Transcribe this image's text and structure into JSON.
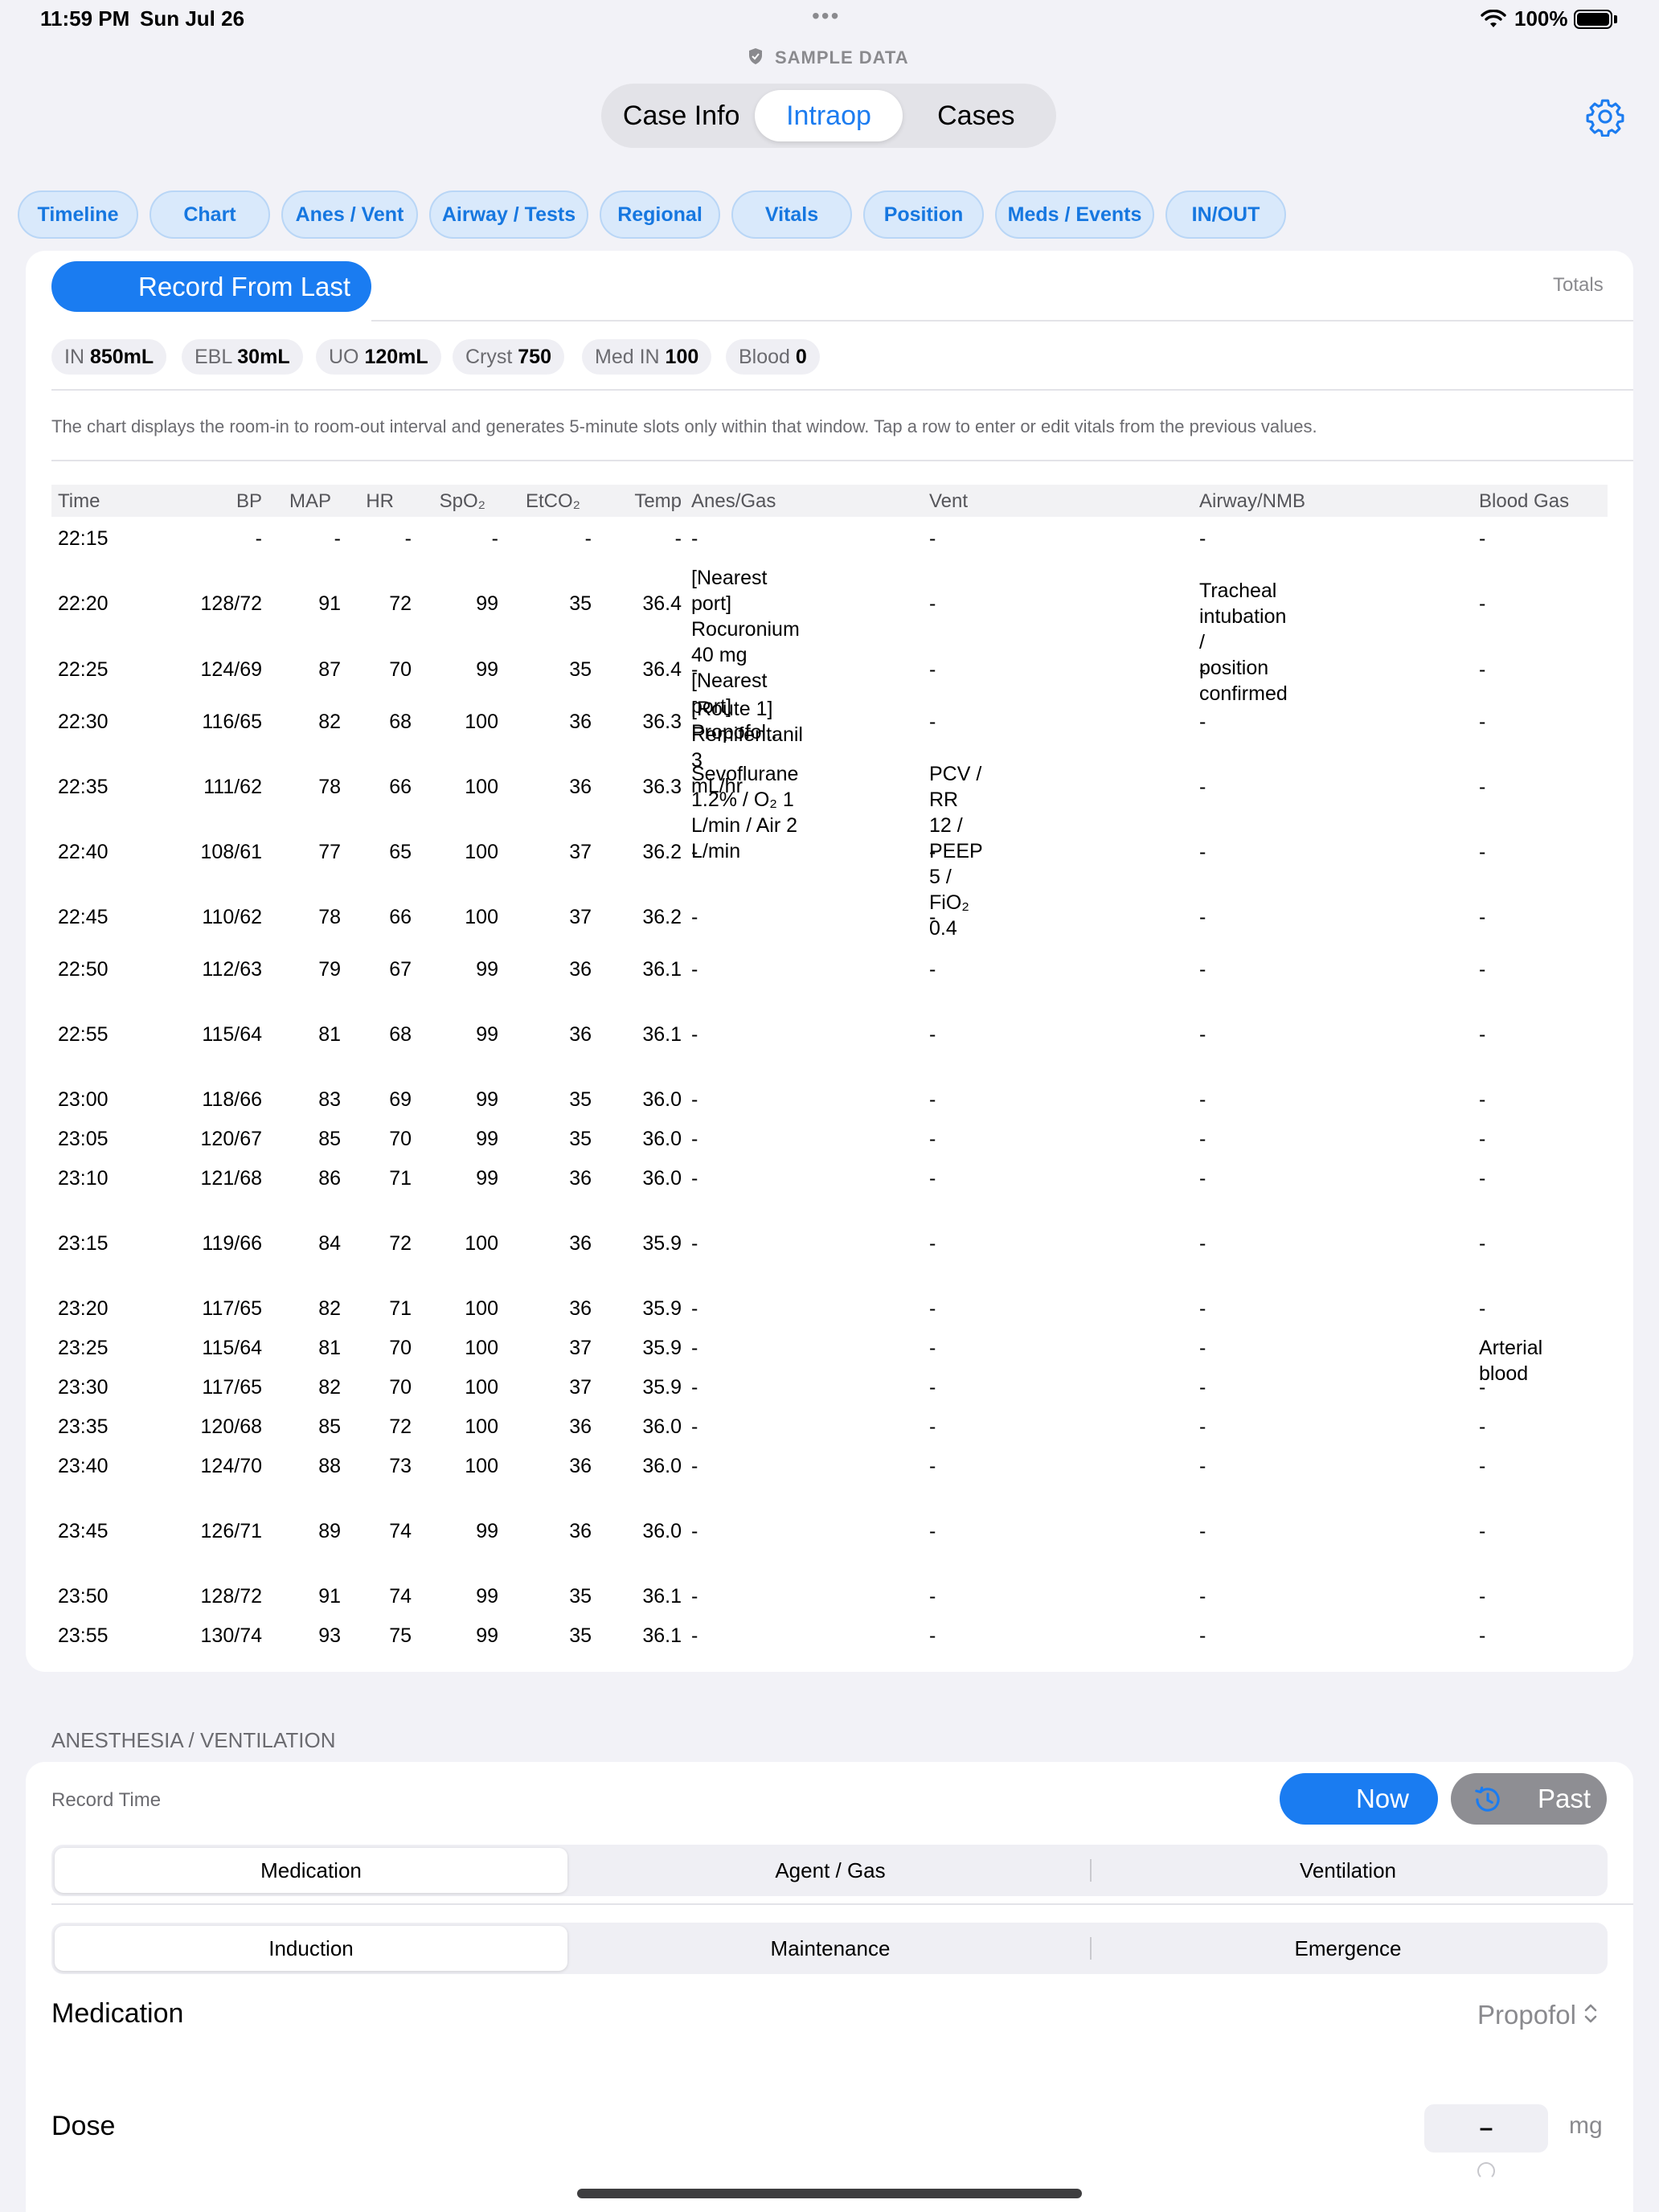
{
  "status_bar": {
    "time": "11:59 PM",
    "date": "Sun Jul 26",
    "dots": "•••",
    "battery": "100%"
  },
  "sample_data_label": "SAMPLE DATA",
  "main_tabs": [
    "Case Info",
    "Intraop",
    "Cases"
  ],
  "section_tabs": [
    "Timeline",
    "Chart",
    "Anes / Vent",
    "Airway / Tests",
    "Regional",
    "Vitals",
    "Position",
    "Meds / Events",
    "IN/OUT"
  ],
  "chart_card": {
    "record_from_last": "Record From Last",
    "totals_label": "Totals",
    "totals": [
      {
        "label": "IN",
        "value": "850mL"
      },
      {
        "label": "EBL",
        "value": "30mL"
      },
      {
        "label": "UO",
        "value": "120mL"
      },
      {
        "label": "Cryst",
        "value": "750"
      },
      {
        "label": "Med IN",
        "value": "100"
      },
      {
        "label": "Blood",
        "value": "0"
      }
    ],
    "description": "The chart displays the room-in to room-out interval and generates 5-minute slots only within that window. Tap a row to enter or edit vitals from the previous values."
  },
  "table": {
    "headers": [
      "Time",
      "BP",
      "MAP",
      "HR",
      "SpO₂",
      "EtCO₂",
      "Temp",
      "Anes/Gas",
      "Vent",
      "Airway/NMB",
      "Blood Gas"
    ],
    "rows": [
      [
        "22:15",
        "-",
        "-",
        "-",
        "-",
        "-",
        "-",
        "-",
        "-",
        "-",
        "-"
      ],
      [
        "22:20",
        "128/72",
        "91",
        "72",
        "99",
        "35",
        "36.4",
        "[Nearest port]\nRocuronium 40 mg\n[Nearest port] Propofol...",
        "-",
        "Tracheal intubation /\nposition confirmed",
        "-"
      ],
      [
        "22:25",
        "124/69",
        "87",
        "70",
        "99",
        "35",
        "36.4",
        "-",
        "-",
        "-",
        "-"
      ],
      [
        "22:30",
        "116/65",
        "82",
        "68",
        "100",
        "36",
        "36.3",
        "[Route 1] Remifentanil 3\nmL/hr",
        "-",
        "-",
        "-"
      ],
      [
        "22:35",
        "111/62",
        "78",
        "66",
        "100",
        "36",
        "36.3",
        "Sevoflurane 1.2% / O₂ 1\nL/min / Air 2 L/min",
        "PCV / RR 12 / PEEP 5 /\nFiO₂ 0.4",
        "-",
        "-"
      ],
      [
        "22:40",
        "108/61",
        "77",
        "65",
        "100",
        "37",
        "36.2",
        "-",
        "-",
        "-",
        "-"
      ],
      [
        "22:45",
        "110/62",
        "78",
        "66",
        "100",
        "37",
        "36.2",
        "-",
        "-",
        "-",
        "-"
      ],
      [
        "22:50",
        "112/63",
        "79",
        "67",
        "99",
        "36",
        "36.1",
        "-",
        "-",
        "-",
        "-"
      ],
      [
        "22:55",
        "115/64",
        "81",
        "68",
        "99",
        "36",
        "36.1",
        "-",
        "-",
        "-",
        "-"
      ],
      [
        "23:00",
        "118/66",
        "83",
        "69",
        "99",
        "35",
        "36.0",
        "-",
        "-",
        "-",
        "-"
      ],
      [
        "23:05",
        "120/67",
        "85",
        "70",
        "99",
        "35",
        "36.0",
        "-",
        "-",
        "-",
        "-"
      ],
      [
        "23:10",
        "121/68",
        "86",
        "71",
        "99",
        "36",
        "36.0",
        "-",
        "-",
        "-",
        "-"
      ],
      [
        "23:15",
        "119/66",
        "84",
        "72",
        "100",
        "36",
        "35.9",
        "-",
        "-",
        "-",
        "-"
      ],
      [
        "23:20",
        "117/65",
        "82",
        "71",
        "100",
        "36",
        "35.9",
        "-",
        "-",
        "-",
        "-"
      ],
      [
        "23:25",
        "115/64",
        "81",
        "70",
        "100",
        "37",
        "35.9",
        "-",
        "-",
        "-",
        "Arterial blood"
      ],
      [
        "23:30",
        "117/65",
        "82",
        "70",
        "100",
        "37",
        "35.9",
        "-",
        "-",
        "-",
        "-"
      ],
      [
        "23:35",
        "120/68",
        "85",
        "72",
        "100",
        "36",
        "36.0",
        "-",
        "-",
        "-",
        "-"
      ],
      [
        "23:40",
        "124/70",
        "88",
        "73",
        "100",
        "36",
        "36.0",
        "-",
        "-",
        "-",
        "-"
      ],
      [
        "23:45",
        "126/71",
        "89",
        "74",
        "99",
        "36",
        "36.0",
        "-",
        "-",
        "-",
        "-"
      ],
      [
        "23:50",
        "128/72",
        "91",
        "74",
        "99",
        "35",
        "36.1",
        "-",
        "-",
        "-",
        "-"
      ],
      [
        "23:55",
        "130/74",
        "93",
        "75",
        "99",
        "35",
        "36.1",
        "-",
        "-",
        "-",
        "-"
      ]
    ]
  },
  "anes_section": {
    "title": "ANESTHESIA / VENTILATION",
    "record_time_label": "Record Time",
    "now_button": "Now",
    "past_button": "Past",
    "category_segments": [
      "Medication",
      "Agent / Gas",
      "Ventilation"
    ],
    "phase_segments": [
      "Induction",
      "Maintenance",
      "Emergence"
    ],
    "medication_label": "Medication",
    "medication_value": "Propofol",
    "dose_label": "Dose",
    "dose_value": "–",
    "dose_unit": "mg"
  },
  "colors": {
    "accent": "#1a7cf1",
    "pill_bg": "#d9e9fb",
    "background": "#f2f2f7"
  }
}
